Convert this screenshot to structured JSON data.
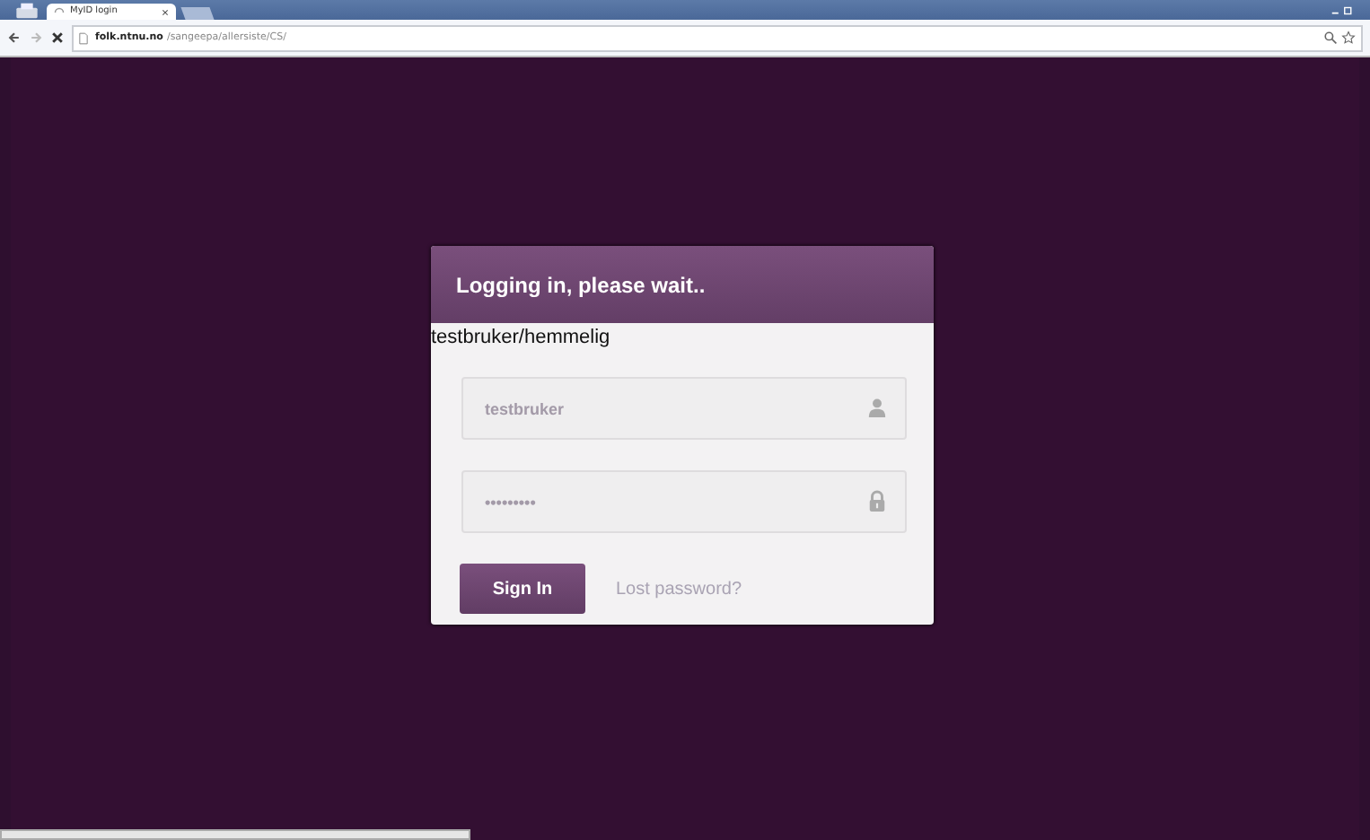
{
  "browser": {
    "tab_title": "MyID login",
    "url_host": "folk.ntnu.no",
    "url_path": "/sangeepa/allersiste/CS/"
  },
  "card": {
    "title": "Logging in, please wait..",
    "credentials_note": "testbruker/hemmelig",
    "username": {
      "value": "testbruker"
    },
    "password": {
      "value": "•••••••••"
    },
    "sign_in": "Sign In",
    "lost_password": "Lost password?"
  }
}
